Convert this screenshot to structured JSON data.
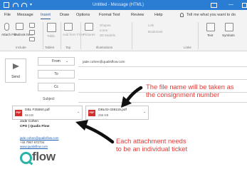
{
  "window": {
    "title": "Untitled - Message (HTML)"
  },
  "ribbon_tabs": [
    "File",
    "Message",
    "Insert",
    "Draw",
    "Options",
    "Format Text",
    "Review",
    "Help"
  ],
  "active_tab": "Insert",
  "tell_me": "Tell me what you want to do",
  "ribbon": {
    "attach_file": "Attach File",
    "outlook_item": "Outlook Item",
    "table": "Table",
    "pictures": "Pictures",
    "shapes": "Shapes",
    "icons": "Icons",
    "models_3d": "3D Models",
    "add_from_files": "Add from Files",
    "link": "Link",
    "bookmark": "Bookmark",
    "text": "Text",
    "symbols": "Symbols",
    "groups": {
      "include": "Include",
      "tables": "Tables",
      "tap": "Tap",
      "illustrations": "Illustrations",
      "links": "Links"
    }
  },
  "form": {
    "send_label": "Send",
    "from_label": "From",
    "from_value": "jade.cohen@qualisflow.com",
    "to_label": "To",
    "cc_label": "Cc",
    "subject_label": "Subject"
  },
  "attachments": [
    {
      "name": "DBL F35550.pdf",
      "size": "96 KB",
      "type": "PDF"
    },
    {
      "name": "DBL02-338115.pdf",
      "size": "256 KB",
      "type": "PDF"
    }
  ],
  "annotations": {
    "filename_line1": "The file name will be taken as",
    "filename_line2": "the consignment number",
    "ticket_line1": "Each attachment needs",
    "ticket_line2": "to be an individual ticket"
  },
  "signature": {
    "name": "Jade Cohen",
    "title": "CPO | Qualis Flow",
    "email": "jade.cohen@qualisflow.com",
    "phone": "+44 7957 672734",
    "website": "www.qualisflow.com",
    "logo_text": "flow"
  },
  "colors": {
    "titlebar": "#2b7cd3",
    "annotation": "#e53935",
    "logo": "#2bb3a6",
    "pdf": "#d32f2f"
  }
}
